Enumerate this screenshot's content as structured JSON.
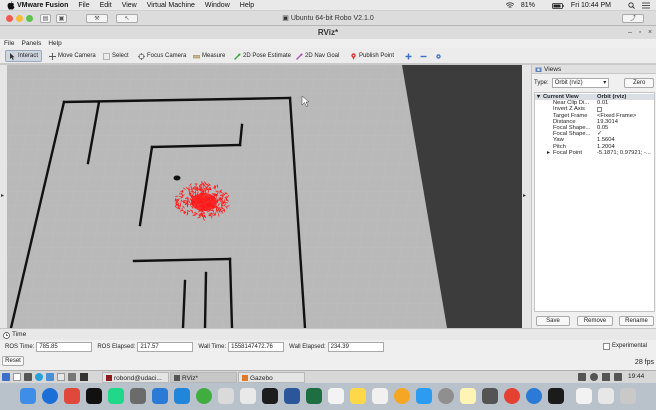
{
  "mac_menubar": {
    "app_name": "VMware Fusion",
    "items": [
      "File",
      "Edit",
      "View",
      "Virtual Machine",
      "Window",
      "Help"
    ],
    "battery": "81%",
    "clock": "Fri 10:44 PM"
  },
  "vm_window": {
    "title": "Ubuntu 64-bit Robo V2.1.0"
  },
  "rviz": {
    "title": "RViz*",
    "menu": [
      "File",
      "Panels",
      "Help"
    ],
    "tools": [
      {
        "label": "Interact",
        "icon": "interact-icon",
        "active": true
      },
      {
        "label": "Move Camera",
        "icon": "move-camera-icon",
        "active": false
      },
      {
        "label": "Select",
        "icon": "select-icon",
        "active": false
      },
      {
        "label": "Focus Camera",
        "icon": "focus-camera-icon",
        "active": false
      },
      {
        "label": "Measure",
        "icon": "measure-icon",
        "active": false
      },
      {
        "label": "2D Pose Estimate",
        "icon": "pose-estimate-icon",
        "active": false
      },
      {
        "label": "2D Nav Goal",
        "icon": "nav-goal-icon",
        "active": false
      },
      {
        "label": "Publish Point",
        "icon": "publish-point-icon",
        "active": false
      }
    ]
  },
  "views_panel": {
    "header": "Views",
    "type_label": "Type:",
    "type_value": "Orbit (rviz)",
    "zero_label": "Zero",
    "properties": [
      {
        "key": "Current View",
        "value": "Orbit (rviz)",
        "level": 0,
        "expand": "▾",
        "highlight": true
      },
      {
        "key": "Near Clip Di...",
        "value": "0.01",
        "level": 1,
        "expand": "",
        "highlight": false
      },
      {
        "key": "Invert Z Axis",
        "value": "",
        "level": 1,
        "expand": "",
        "highlight": false
      },
      {
        "key": "Target Frame",
        "value": "<Fixed Frame>",
        "level": 1,
        "expand": "",
        "highlight": false
      },
      {
        "key": "Distance",
        "value": "19.3014",
        "level": 1,
        "expand": "",
        "highlight": false
      },
      {
        "key": "Focal Shape...",
        "value": "0.05",
        "level": 1,
        "expand": "",
        "highlight": false
      },
      {
        "key": "Focal Shape...",
        "value": "✓",
        "level": 1,
        "expand": "",
        "highlight": false
      },
      {
        "key": "Yaw",
        "value": "1.5604",
        "level": 1,
        "expand": "",
        "highlight": false
      },
      {
        "key": "Pitch",
        "value": "1.2004",
        "level": 1,
        "expand": "",
        "highlight": false
      },
      {
        "key": "Focal Point",
        "value": "-5.1871; 0.97921; -...",
        "level": 1,
        "expand": "▸",
        "highlight": false
      }
    ],
    "buttons": {
      "save": "Save",
      "remove": "Remove",
      "rename": "Rename"
    }
  },
  "time_panel": {
    "header": "Time",
    "ros_time_label": "ROS Time:",
    "ros_time": "785.85",
    "ros_elapsed_label": "ROS Elapsed:",
    "ros_elapsed": "217.57",
    "wall_time_label": "Wall Time:",
    "wall_time": "1558147472.76",
    "wall_elapsed_label": "Wall Elapsed:",
    "wall_elapsed": "234.39",
    "experimental_label": "Experimental",
    "reset_label": "Reset",
    "fps": "28 fps"
  },
  "ubuntu_taskbar": {
    "items": [
      "robond@udaci...",
      "RViz*",
      "Gazebo"
    ],
    "clock": "19:44"
  },
  "colors": {
    "particles": "#ff1a1a",
    "ground": "#b9b9b9",
    "walls": "#111111",
    "selection": "#cfd6e0"
  }
}
